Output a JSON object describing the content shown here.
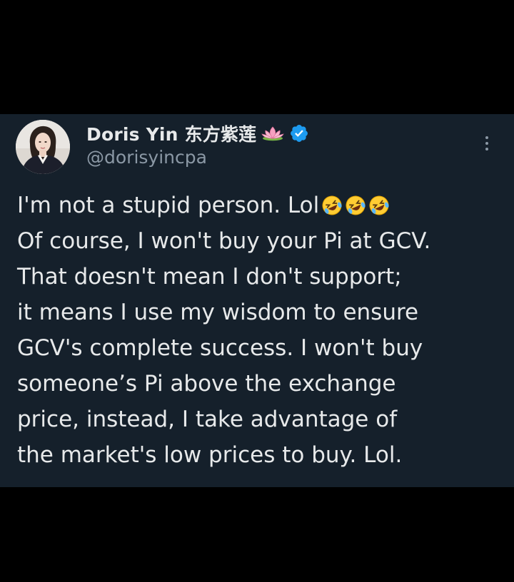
{
  "tweet": {
    "author": {
      "display_name": "Doris Yin 东方紫莲",
      "handle": "@dorisyincpa",
      "verified": true,
      "name_emoji": "lotus-icon",
      "verified_color": "#1d9bf0"
    },
    "text_lines": [
      "I'm not a stupid person. Lol",
      "Of course, I won't buy your Pi at GCV.",
      "That doesn't mean I don't support;",
      "it means I use my wisdom to ensure",
      "GCV's complete success. I won't buy",
      "someone’s Pi above the exchange",
      "price, instead, I  take advantage of",
      "the market's low prices to buy. Lol."
    ],
    "line1_emojis": [
      "rolling-on-floor-laughing-emoji",
      "rolling-on-floor-laughing-emoji",
      "rolling-on-floor-laughing-emoji"
    ],
    "more_icon": "more-vertical-icon"
  },
  "colors": {
    "card_background": "#15202b",
    "page_background": "#000000",
    "primary_text": "#e7e9ea",
    "secondary_text": "#8b98a5"
  }
}
